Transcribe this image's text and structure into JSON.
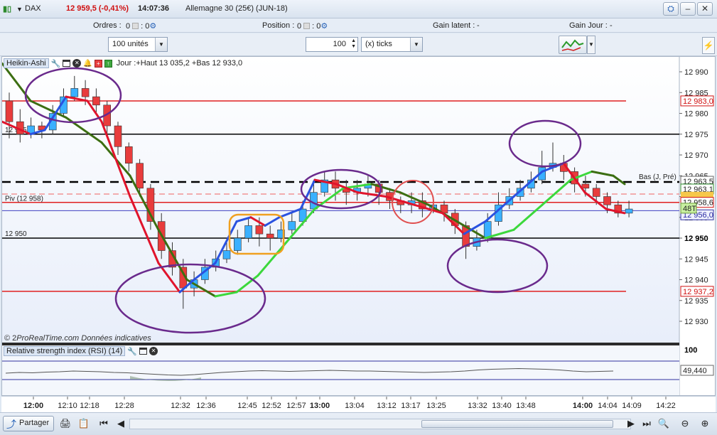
{
  "window": {
    "symbol": "DAX",
    "price_change": "12 959,5 (-0,41%)",
    "time": "14:07:36",
    "instrument": "Allemagne 30 (25€) (JUN-18)"
  },
  "infobar": {
    "orders_label": "Ordres :",
    "orders_value": "0",
    "orders_value2": "0",
    "position_label": "Position :",
    "position_value": "0",
    "position_value2": "0",
    "gain_latent_label": "Gain latent :",
    "gain_latent_value": "-",
    "gain_jour_label": "Gain Jour :",
    "gain_jour_value": "-"
  },
  "toolbar": {
    "units_select": "100 unités",
    "quantity_value": "100",
    "ticks_select": "(x) ticks"
  },
  "panel": {
    "chart_type": "Heikin-Ashi",
    "day_info": "Jour :+Haut 13 035,2 +Bas 12 933,0",
    "watermark": "ProRealTime.com  Données indicatives",
    "watermark_prefix": "© 2",
    "rsi_title": "Relative strength index (RSI) (14)",
    "rsi_value": "49,440",
    "rsi_scale_top": "100"
  },
  "chart_data": {
    "type": "candlestick",
    "y_ticks": [
      "12 990",
      "12 985",
      "12 980",
      "12 975",
      "12 970",
      "12 965",
      "12 960",
      "12 955",
      "12 950",
      "12 945",
      "12 940",
      "12 935",
      "12 930"
    ],
    "x_ticks": [
      "12:00",
      "12:10",
      "12:18",
      "12:28",
      "12:32",
      "12:36",
      "12:45",
      "12:52",
      "12:57",
      "13:00",
      "13:04",
      "13:12",
      "13:17",
      "13:25",
      "13:32",
      "13:40",
      "13:48",
      "14:00",
      "14:04",
      "14:09",
      "14:22"
    ],
    "line_labels": {
      "left_12975": "12 975",
      "pivot": "Piv (12 958)",
      "left_12950": "12 950",
      "bas_label": "Bas (J, Pré)"
    },
    "price_tags": {
      "r1": "12 983,0",
      "bas": "12 963,5",
      "ma": "12 963,1",
      "pivot": "12 958,6",
      "current": "12 956,0",
      "bold_12950": "12 950",
      "s1": "12 937,2",
      "countdown": "48T"
    },
    "horizontal_lines": [
      {
        "name": "R1",
        "value": 12983.0,
        "color": "#e02020"
      },
      {
        "name": "12 975",
        "value": 12975,
        "color": "#000000"
      },
      {
        "name": "Bas (J, Pré)",
        "value": 12963.5,
        "color": "#000000",
        "style": "dashed"
      },
      {
        "name": "Pivot",
        "value": 12958.6,
        "color": "#e02020"
      },
      {
        "name": "12 950",
        "value": 12950,
        "color": "#000000"
      },
      {
        "name": "S1",
        "value": 12937.2,
        "color": "#e02020"
      }
    ],
    "ylim": [
      12927,
      12993
    ],
    "colors": {
      "up": "#3ab0ff",
      "down": "#e83c3c",
      "ma_slow_up": "#3cd83c",
      "ma_slow_down": "#3c6e12",
      "ma_fast_up": "#2a52e0",
      "ma_fast_down": "#e0142c",
      "annotation": "#6a2a8c"
    }
  },
  "bottombar": {
    "share_label": "Partager"
  }
}
